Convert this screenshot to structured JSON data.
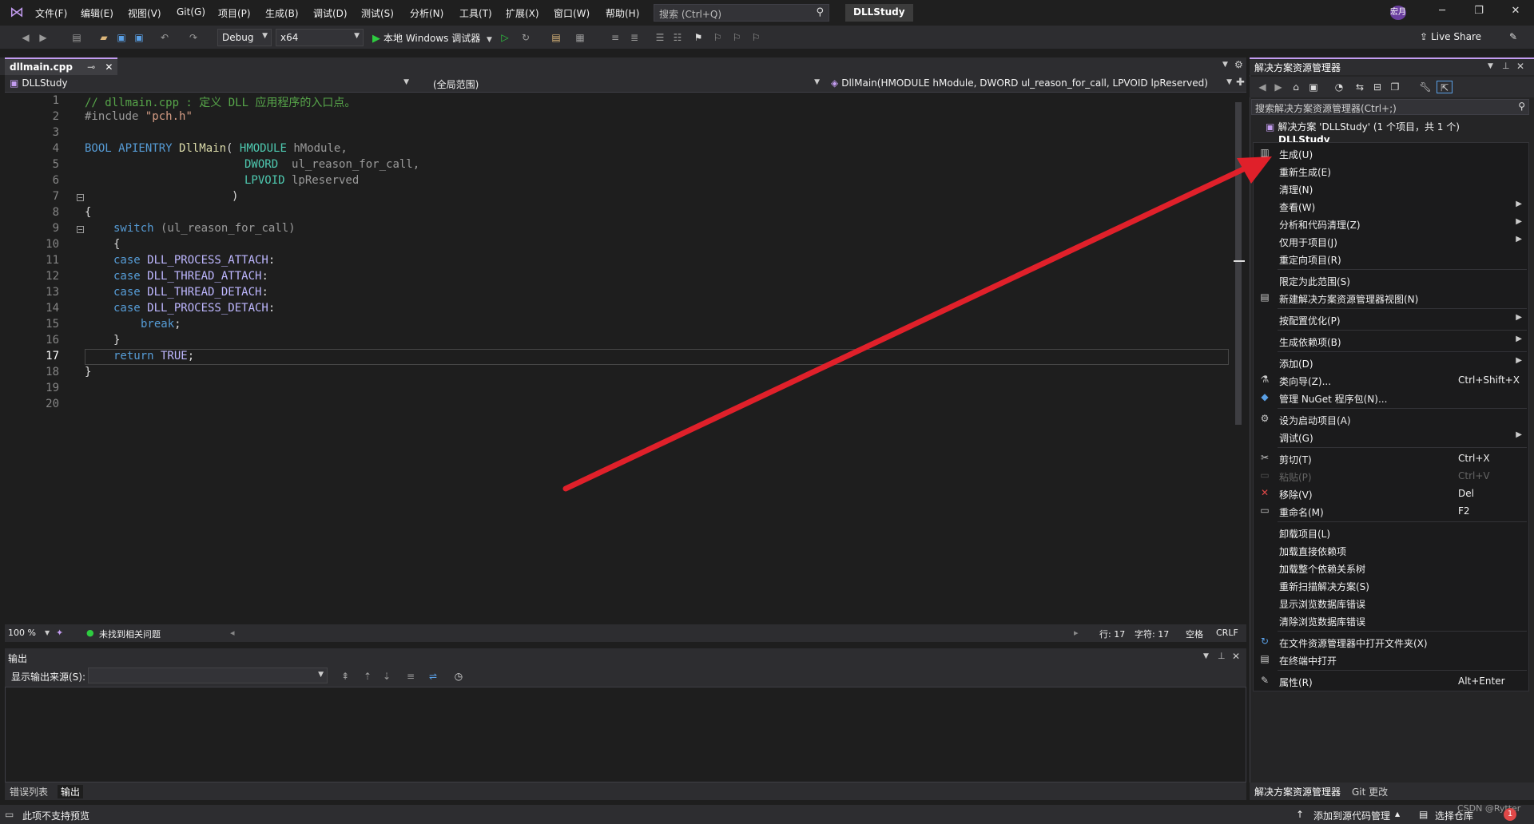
{
  "menu": [
    "文件(F)",
    "编辑(E)",
    "视图(V)",
    "Git(G)",
    "项目(P)",
    "生成(B)",
    "调试(D)",
    "测试(S)",
    "分析(N)",
    "工具(T)",
    "扩展(X)",
    "窗口(W)",
    "帮助(H)"
  ],
  "search": {
    "placeholder": "搜索 (Ctrl+Q)"
  },
  "solution_name": "DLLStudy",
  "avatar": "宏月",
  "toolbar": {
    "config": "Debug",
    "platform": "x64",
    "run_label": "本地 Windows 调试器",
    "live_share": "Live Share"
  },
  "editor": {
    "tab": "dllmain.cpp",
    "nav_project": "DLLStudy",
    "nav_scope": "(全局范围)",
    "nav_member": "DllMain(HMODULE hModule, DWORD ul_reason_for_call, LPVOID lpReserved)",
    "line_numbers": [
      "1",
      "2",
      "3",
      "4",
      "5",
      "6",
      "7",
      "8",
      "9",
      "10",
      "11",
      "12",
      "13",
      "14",
      "15",
      "16",
      "17",
      "18",
      "19",
      "20"
    ],
    "current_line": "17"
  },
  "code": {
    "l1": "// dllmain.cpp : 定义 DLL 应用程序的入口点。",
    "l2_kw": "#include",
    "l2_str": "\"pch.h\"",
    "l4_a": "BOOL APIENTRY ",
    "l4_fn": "DllMain",
    "l4_b": "( ",
    "l4_t": "HMODULE",
    "l4_p": " hModule,",
    "l5_t": "DWORD",
    "l5_p": "  ul_reason_for_call,",
    "l6_t": "LPVOID",
    "l6_p": " lpReserved",
    "l7": ")",
    "l8": "{",
    "l9_kw": "switch",
    "l9_p": " (ul_reason_for_call)",
    "l10": "{",
    "l11_kw": "case",
    "l11_m": " DLL_PROCESS_ATTACH",
    "l12_kw": "case",
    "l12_m": " DLL_THREAD_ATTACH",
    "l13_kw": "case",
    "l13_m": " DLL_THREAD_DETACH",
    "l14_kw": "case",
    "l14_m": " DLL_PROCESS_DETACH",
    "colon": ":",
    "l15_kw": "break",
    "semi": ";",
    "l16": "}",
    "l17_kw": "return",
    "l17_m": " TRUE",
    "l18": "}"
  },
  "editor_status": {
    "zoom": "100 %",
    "issues": "未找到相关问题",
    "line": "行: 17",
    "char": "字符: 17",
    "space": "空格",
    "eol": "CRLF"
  },
  "output": {
    "title": "输出",
    "source_label": "显示输出来源(S):",
    "tabs": [
      "错误列表",
      "输出"
    ]
  },
  "solution_explorer": {
    "title": "解决方案资源管理器",
    "search": "搜索解决方案资源管理器(Ctrl+;)",
    "solution_item": "解决方案 'DLLStudy' (1 个项目，共 1 个)",
    "project_item": "DLLStudy",
    "bottom_tabs": [
      "解决方案资源管理器",
      "Git 更改"
    ]
  },
  "context_menu": [
    {
      "label": "生成(U)",
      "shortcut": "",
      "sub": false,
      "icon": "build-icon",
      "disabled": false
    },
    {
      "label": "重新生成(E)",
      "shortcut": "",
      "sub": false,
      "icon": "",
      "disabled": false
    },
    {
      "label": "清理(N)",
      "shortcut": "",
      "sub": false,
      "icon": "",
      "disabled": false
    },
    {
      "label": "查看(W)",
      "shortcut": "",
      "sub": true,
      "icon": "",
      "disabled": false
    },
    {
      "label": "分析和代码清理(Z)",
      "shortcut": "",
      "sub": true,
      "icon": "",
      "disabled": false
    },
    {
      "label": "仅用于项目(J)",
      "shortcut": "",
      "sub": true,
      "icon": "",
      "disabled": false
    },
    {
      "label": "重定向项目(R)",
      "shortcut": "",
      "sub": false,
      "icon": "",
      "disabled": false
    },
    {
      "label": "限定为此范围(S)",
      "shortcut": "",
      "sub": false,
      "icon": "",
      "disabled": false
    },
    {
      "label": "新建解决方案资源管理器视图(N)",
      "shortcut": "",
      "sub": false,
      "icon": "new-view-icon",
      "disabled": false
    },
    {
      "label": "按配置优化(P)",
      "shortcut": "",
      "sub": true,
      "icon": "",
      "disabled": false
    },
    {
      "label": "生成依赖项(B)",
      "shortcut": "",
      "sub": true,
      "icon": "",
      "disabled": false
    },
    {
      "label": "添加(D)",
      "shortcut": "",
      "sub": true,
      "icon": "",
      "disabled": false
    },
    {
      "label": "类向导(Z)...",
      "shortcut": "Ctrl+Shift+X",
      "sub": false,
      "icon": "class-wizard-icon",
      "disabled": false
    },
    {
      "label": "管理 NuGet 程序包(N)...",
      "shortcut": "",
      "sub": false,
      "icon": "nuget-icon",
      "disabled": false
    },
    {
      "label": "设为启动项目(A)",
      "shortcut": "",
      "sub": false,
      "icon": "gear-icon",
      "disabled": false
    },
    {
      "label": "调试(G)",
      "shortcut": "",
      "sub": true,
      "icon": "",
      "disabled": false
    },
    {
      "label": "剪切(T)",
      "shortcut": "Ctrl+X",
      "sub": false,
      "icon": "scissors-icon",
      "disabled": false
    },
    {
      "label": "粘贴(P)",
      "shortcut": "Ctrl+V",
      "sub": false,
      "icon": "paste-icon",
      "disabled": true
    },
    {
      "label": "移除(V)",
      "shortcut": "Del",
      "sub": false,
      "icon": "remove-icon",
      "disabled": false
    },
    {
      "label": "重命名(M)",
      "shortcut": "F2",
      "sub": false,
      "icon": "rename-icon",
      "disabled": false
    },
    {
      "label": "卸载项目(L)",
      "shortcut": "",
      "sub": false,
      "icon": "",
      "disabled": false
    },
    {
      "label": "加载直接依赖项",
      "shortcut": "",
      "sub": false,
      "icon": "",
      "disabled": false
    },
    {
      "label": "加载整个依赖关系树",
      "shortcut": "",
      "sub": false,
      "icon": "",
      "disabled": false
    },
    {
      "label": "重新扫描解决方案(S)",
      "shortcut": "",
      "sub": false,
      "icon": "",
      "disabled": false
    },
    {
      "label": "显示浏览数据库错误",
      "shortcut": "",
      "sub": false,
      "icon": "",
      "disabled": false
    },
    {
      "label": "清除浏览数据库错误",
      "shortcut": "",
      "sub": false,
      "icon": "",
      "disabled": false
    },
    {
      "label": "在文件资源管理器中打开文件夹(X)",
      "shortcut": "",
      "sub": false,
      "icon": "refresh-icon",
      "disabled": false
    },
    {
      "label": "在终端中打开",
      "shortcut": "",
      "sub": false,
      "icon": "terminal-icon",
      "disabled": false
    },
    {
      "label": "属性(R)",
      "shortcut": "Alt+Enter",
      "sub": false,
      "icon": "wrench-icon",
      "disabled": false
    }
  ],
  "statusbar": {
    "left": "此项不支持预览",
    "source_control": "添加到源代码管理",
    "repo": "选择仓库",
    "watermark": "CSDN @Rytter",
    "notifications": "1"
  },
  "colors": {
    "accent": "#c39cf0",
    "arrow": "#e0202a",
    "keyword": "#569cd6",
    "comment": "#57a64a",
    "macro": "#beb7ff"
  }
}
